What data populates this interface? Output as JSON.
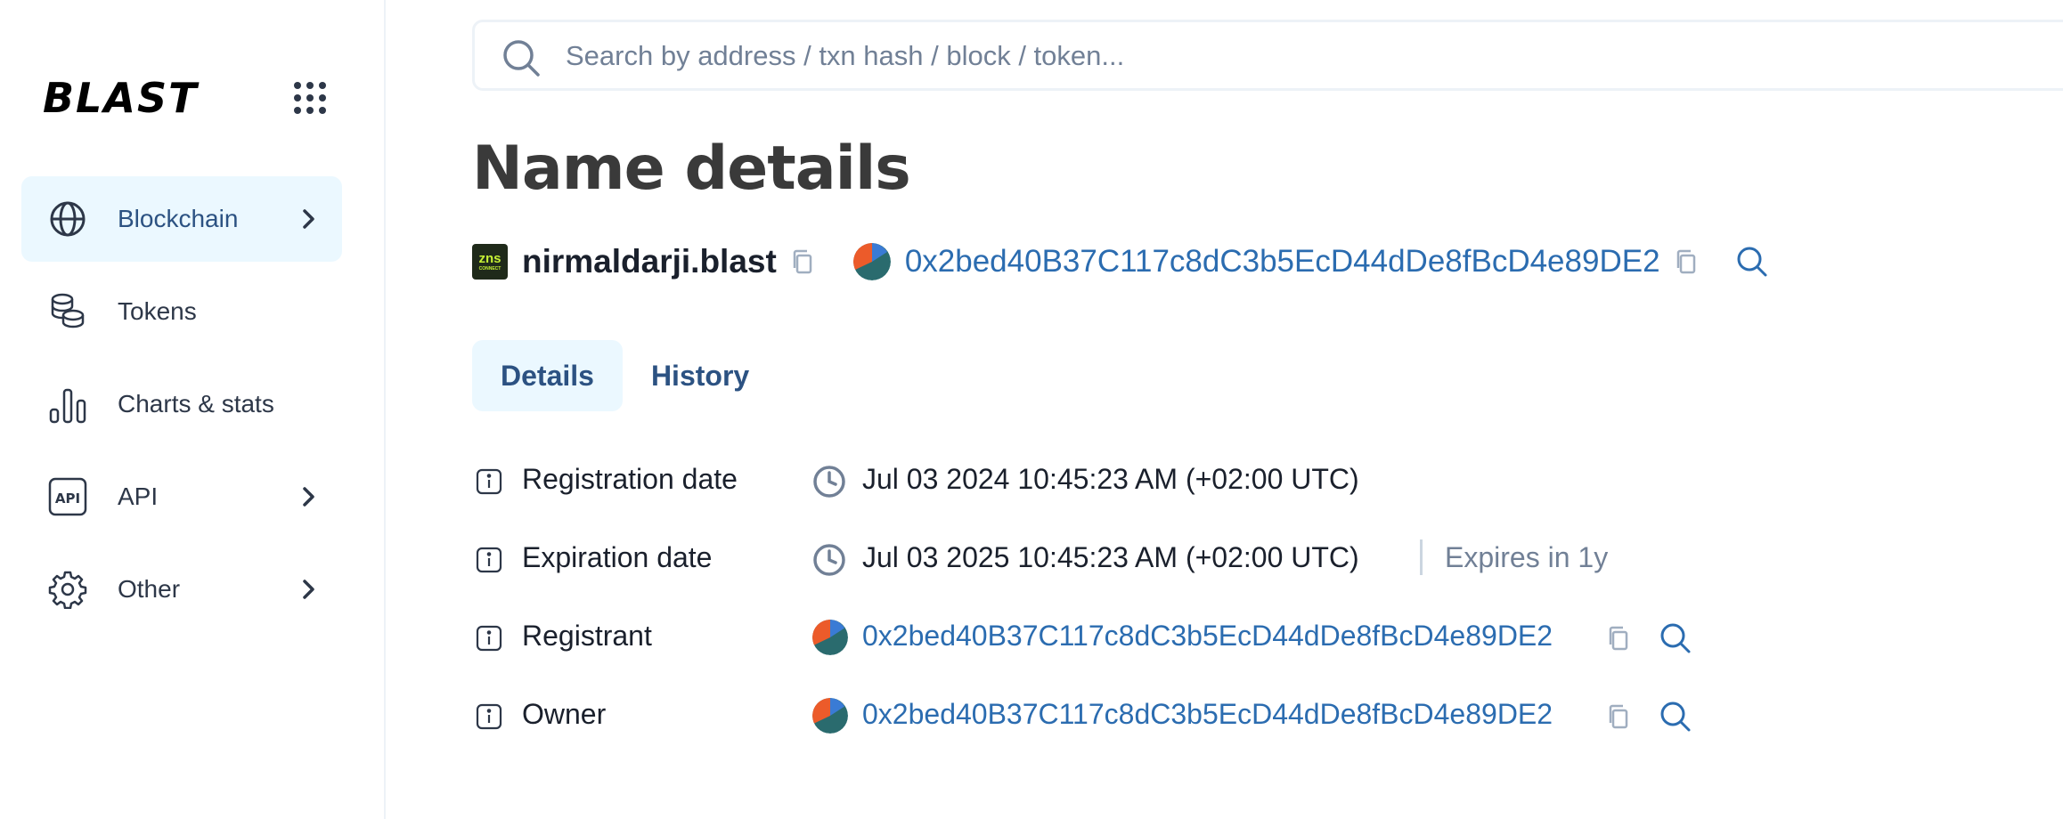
{
  "brand": {
    "logo_text": "BLAST"
  },
  "sidebar": {
    "items": [
      {
        "label": "Blockchain",
        "icon": "globe-icon",
        "active": true,
        "has_chevron": true
      },
      {
        "label": "Tokens",
        "icon": "coins-icon",
        "active": false,
        "has_chevron": false
      },
      {
        "label": "Charts & stats",
        "icon": "bar-chart-icon",
        "active": false,
        "has_chevron": false
      },
      {
        "label": "API",
        "icon": "api-icon",
        "active": false,
        "has_chevron": true
      },
      {
        "label": "Other",
        "icon": "gear-icon",
        "active": false,
        "has_chevron": true
      }
    ]
  },
  "search": {
    "placeholder": "Search by address / txn hash / block / token..."
  },
  "page": {
    "title": "Name details"
  },
  "name": {
    "domain": "nirmaldarji.blast",
    "badge_text": "zns",
    "badge_subtext": "CONNECT",
    "address": "0x2bed40B37C117c8dC3b5EcD44dDe8fBcD4e89DE2"
  },
  "tabs": [
    {
      "label": "Details",
      "active": true
    },
    {
      "label": "History",
      "active": false
    }
  ],
  "details": {
    "registration": {
      "label": "Registration date",
      "value": "Jul 03 2024 10:45:23 AM (+02:00 UTC)"
    },
    "expiration": {
      "label": "Expiration date",
      "value": "Jul 03 2025 10:45:23 AM (+02:00 UTC)",
      "note": "Expires in 1y"
    },
    "registrant": {
      "label": "Registrant",
      "value": "0x2bed40B37C117c8dC3b5EcD44dDe8fBcD4e89DE2"
    },
    "owner": {
      "label": "Owner",
      "value": "0x2bed40B37C117c8dC3b5EcD44dDe8fBcD4e89DE2"
    }
  },
  "colors": {
    "accent": "#2b6cb0",
    "active_bg": "#ebf8ff",
    "text": "#1a202c",
    "muted": "#718096"
  }
}
